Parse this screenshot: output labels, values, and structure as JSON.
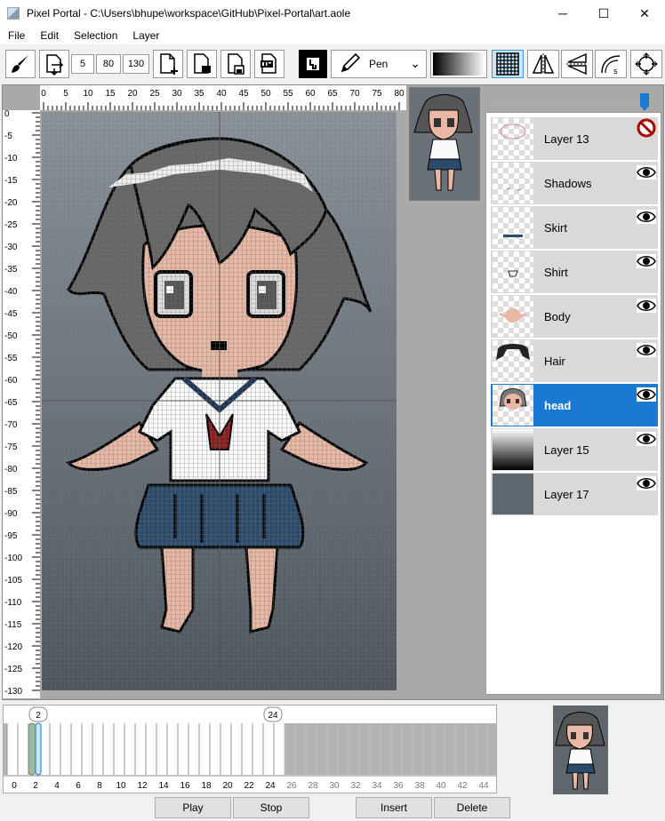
{
  "window": {
    "title": "Pixel Portal - C:\\Users\\bhupe\\workspace\\GitHub\\Pixel-Portal\\art.aole",
    "minimize": "─",
    "maximize": "☐",
    "close": "✕"
  },
  "menu": [
    "File",
    "Edit",
    "Selection",
    "Layer"
  ],
  "toolbar": {
    "brush_size": "5",
    "canvas_width": "80",
    "canvas_height": "130",
    "tool_label": "Pen",
    "tool_arrow": "⌄"
  },
  "ruler": {
    "h_ticks": [
      "0",
      "5",
      "10",
      "15",
      "20",
      "25",
      "30",
      "35",
      "40",
      "45",
      "50",
      "55",
      "60",
      "65",
      "70",
      "75",
      "80"
    ],
    "v_ticks": [
      "0",
      "-5",
      "-10",
      "-15",
      "-20",
      "-25",
      "-30",
      "-35",
      "-40",
      "-45",
      "-50",
      "-55",
      "-60",
      "-65",
      "-70",
      "-75",
      "-80",
      "-85",
      "-90",
      "-95",
      "-100",
      "-105",
      "-110",
      "-115",
      "-120",
      "-125",
      "-130"
    ]
  },
  "layers": [
    {
      "name": "Layer 13",
      "visible": false
    },
    {
      "name": "Shadows",
      "visible": true
    },
    {
      "name": "Skirt",
      "visible": true
    },
    {
      "name": "Shirt",
      "visible": true
    },
    {
      "name": "Body",
      "visible": true
    },
    {
      "name": "Hair",
      "visible": true
    },
    {
      "name": "head",
      "visible": true,
      "selected": true
    },
    {
      "name": "Layer 15",
      "visible": true
    },
    {
      "name": "Layer 17",
      "visible": true
    }
  ],
  "timeline": {
    "current_frame": "2",
    "end_frame": "24",
    "frame_labels": [
      "0",
      "2",
      "4",
      "6",
      "8",
      "10",
      "12",
      "14",
      "16",
      "18",
      "20",
      "22",
      "24",
      "26",
      "28",
      "30",
      "32",
      "34",
      "36",
      "38",
      "40",
      "42",
      "44"
    ]
  },
  "buttons": {
    "play": "Play",
    "stop": "Stop",
    "insert": "Insert",
    "delete": "Delete"
  },
  "colors": {
    "accent": "#1979d3",
    "canvas_top": "#8a9098",
    "canvas_bottom": "#4e555c"
  }
}
